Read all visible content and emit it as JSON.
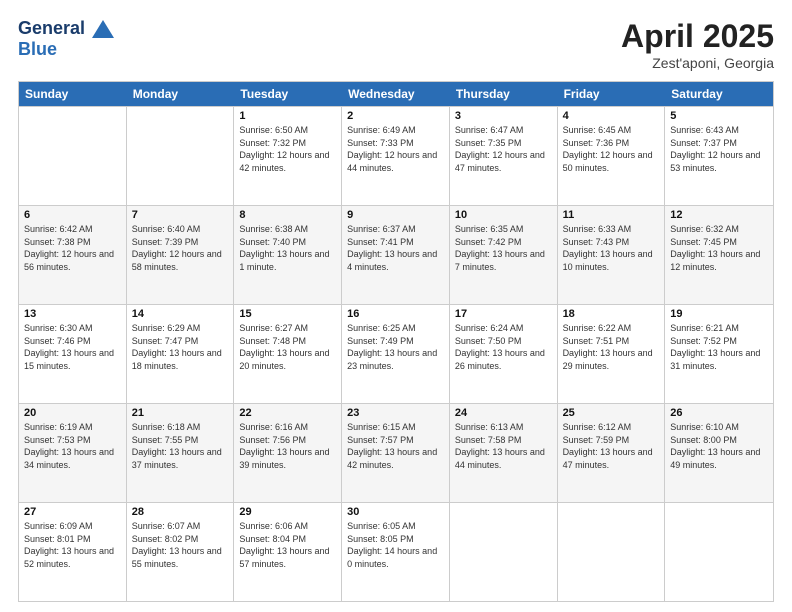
{
  "header": {
    "logo_line1": "General",
    "logo_line2": "Blue",
    "month": "April 2025",
    "location": "Zest'aponi, Georgia"
  },
  "weekdays": [
    "Sunday",
    "Monday",
    "Tuesday",
    "Wednesday",
    "Thursday",
    "Friday",
    "Saturday"
  ],
  "weeks": [
    [
      {
        "day": "",
        "sunrise": "",
        "sunset": "",
        "daylight": ""
      },
      {
        "day": "",
        "sunrise": "",
        "sunset": "",
        "daylight": ""
      },
      {
        "day": "1",
        "sunrise": "Sunrise: 6:50 AM",
        "sunset": "Sunset: 7:32 PM",
        "daylight": "Daylight: 12 hours and 42 minutes."
      },
      {
        "day": "2",
        "sunrise": "Sunrise: 6:49 AM",
        "sunset": "Sunset: 7:33 PM",
        "daylight": "Daylight: 12 hours and 44 minutes."
      },
      {
        "day": "3",
        "sunrise": "Sunrise: 6:47 AM",
        "sunset": "Sunset: 7:35 PM",
        "daylight": "Daylight: 12 hours and 47 minutes."
      },
      {
        "day": "4",
        "sunrise": "Sunrise: 6:45 AM",
        "sunset": "Sunset: 7:36 PM",
        "daylight": "Daylight: 12 hours and 50 minutes."
      },
      {
        "day": "5",
        "sunrise": "Sunrise: 6:43 AM",
        "sunset": "Sunset: 7:37 PM",
        "daylight": "Daylight: 12 hours and 53 minutes."
      }
    ],
    [
      {
        "day": "6",
        "sunrise": "Sunrise: 6:42 AM",
        "sunset": "Sunset: 7:38 PM",
        "daylight": "Daylight: 12 hours and 56 minutes."
      },
      {
        "day": "7",
        "sunrise": "Sunrise: 6:40 AM",
        "sunset": "Sunset: 7:39 PM",
        "daylight": "Daylight: 12 hours and 58 minutes."
      },
      {
        "day": "8",
        "sunrise": "Sunrise: 6:38 AM",
        "sunset": "Sunset: 7:40 PM",
        "daylight": "Daylight: 13 hours and 1 minute."
      },
      {
        "day": "9",
        "sunrise": "Sunrise: 6:37 AM",
        "sunset": "Sunset: 7:41 PM",
        "daylight": "Daylight: 13 hours and 4 minutes."
      },
      {
        "day": "10",
        "sunrise": "Sunrise: 6:35 AM",
        "sunset": "Sunset: 7:42 PM",
        "daylight": "Daylight: 13 hours and 7 minutes."
      },
      {
        "day": "11",
        "sunrise": "Sunrise: 6:33 AM",
        "sunset": "Sunset: 7:43 PM",
        "daylight": "Daylight: 13 hours and 10 minutes."
      },
      {
        "day": "12",
        "sunrise": "Sunrise: 6:32 AM",
        "sunset": "Sunset: 7:45 PM",
        "daylight": "Daylight: 13 hours and 12 minutes."
      }
    ],
    [
      {
        "day": "13",
        "sunrise": "Sunrise: 6:30 AM",
        "sunset": "Sunset: 7:46 PM",
        "daylight": "Daylight: 13 hours and 15 minutes."
      },
      {
        "day": "14",
        "sunrise": "Sunrise: 6:29 AM",
        "sunset": "Sunset: 7:47 PM",
        "daylight": "Daylight: 13 hours and 18 minutes."
      },
      {
        "day": "15",
        "sunrise": "Sunrise: 6:27 AM",
        "sunset": "Sunset: 7:48 PM",
        "daylight": "Daylight: 13 hours and 20 minutes."
      },
      {
        "day": "16",
        "sunrise": "Sunrise: 6:25 AM",
        "sunset": "Sunset: 7:49 PM",
        "daylight": "Daylight: 13 hours and 23 minutes."
      },
      {
        "day": "17",
        "sunrise": "Sunrise: 6:24 AM",
        "sunset": "Sunset: 7:50 PM",
        "daylight": "Daylight: 13 hours and 26 minutes."
      },
      {
        "day": "18",
        "sunrise": "Sunrise: 6:22 AM",
        "sunset": "Sunset: 7:51 PM",
        "daylight": "Daylight: 13 hours and 29 minutes."
      },
      {
        "day": "19",
        "sunrise": "Sunrise: 6:21 AM",
        "sunset": "Sunset: 7:52 PM",
        "daylight": "Daylight: 13 hours and 31 minutes."
      }
    ],
    [
      {
        "day": "20",
        "sunrise": "Sunrise: 6:19 AM",
        "sunset": "Sunset: 7:53 PM",
        "daylight": "Daylight: 13 hours and 34 minutes."
      },
      {
        "day": "21",
        "sunrise": "Sunrise: 6:18 AM",
        "sunset": "Sunset: 7:55 PM",
        "daylight": "Daylight: 13 hours and 37 minutes."
      },
      {
        "day": "22",
        "sunrise": "Sunrise: 6:16 AM",
        "sunset": "Sunset: 7:56 PM",
        "daylight": "Daylight: 13 hours and 39 minutes."
      },
      {
        "day": "23",
        "sunrise": "Sunrise: 6:15 AM",
        "sunset": "Sunset: 7:57 PM",
        "daylight": "Daylight: 13 hours and 42 minutes."
      },
      {
        "day": "24",
        "sunrise": "Sunrise: 6:13 AM",
        "sunset": "Sunset: 7:58 PM",
        "daylight": "Daylight: 13 hours and 44 minutes."
      },
      {
        "day": "25",
        "sunrise": "Sunrise: 6:12 AM",
        "sunset": "Sunset: 7:59 PM",
        "daylight": "Daylight: 13 hours and 47 minutes."
      },
      {
        "day": "26",
        "sunrise": "Sunrise: 6:10 AM",
        "sunset": "Sunset: 8:00 PM",
        "daylight": "Daylight: 13 hours and 49 minutes."
      }
    ],
    [
      {
        "day": "27",
        "sunrise": "Sunrise: 6:09 AM",
        "sunset": "Sunset: 8:01 PM",
        "daylight": "Daylight: 13 hours and 52 minutes."
      },
      {
        "day": "28",
        "sunrise": "Sunrise: 6:07 AM",
        "sunset": "Sunset: 8:02 PM",
        "daylight": "Daylight: 13 hours and 55 minutes."
      },
      {
        "day": "29",
        "sunrise": "Sunrise: 6:06 AM",
        "sunset": "Sunset: 8:04 PM",
        "daylight": "Daylight: 13 hours and 57 minutes."
      },
      {
        "day": "30",
        "sunrise": "Sunrise: 6:05 AM",
        "sunset": "Sunset: 8:05 PM",
        "daylight": "Daylight: 14 hours and 0 minutes."
      },
      {
        "day": "",
        "sunrise": "",
        "sunset": "",
        "daylight": ""
      },
      {
        "day": "",
        "sunrise": "",
        "sunset": "",
        "daylight": ""
      },
      {
        "day": "",
        "sunrise": "",
        "sunset": "",
        "daylight": ""
      }
    ]
  ]
}
